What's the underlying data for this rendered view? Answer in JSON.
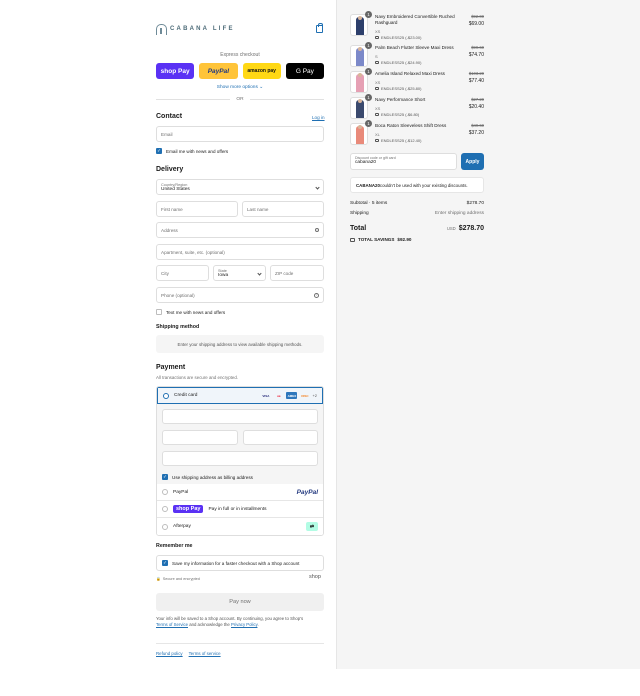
{
  "header": {
    "brand": "CABANA LIFE"
  },
  "express": {
    "title": "Express checkout",
    "shop_pay": "shop Pay",
    "paypal": "PayPal",
    "amazon_pay": "amazon pay",
    "gpay": "G Pay",
    "more": "Show more options ⌄",
    "or": "OR"
  },
  "contact": {
    "title": "Contact",
    "login": "Log in",
    "email_placeholder": "Email",
    "news_label": "Email me with news and offers"
  },
  "delivery": {
    "title": "Delivery",
    "country_label": "Country/Region",
    "country_value": "United States",
    "first_name": "First name",
    "last_name": "Last name",
    "address": "Address",
    "apartment": "Apartment, suite, etc. (optional)",
    "city": "City",
    "state_label": "State",
    "state_value": "Iowa",
    "zip": "ZIP code",
    "phone": "Phone (optional)",
    "text_label": "Text me with news and offers"
  },
  "shipping": {
    "title": "Shipping method",
    "info": "Enter your shipping address to view available shipping methods."
  },
  "payment": {
    "title": "Payment",
    "subtitle": "All transactions are secure and encrypted.",
    "credit_card": "Credit card",
    "cards": [
      "VISA",
      "MC",
      "AMEX",
      "DISC"
    ],
    "more_cards": "+2",
    "billing_label": "Use shipping address as billing address",
    "paypal": "PayPal",
    "paypal_logo": "PayPal",
    "shop_pay_logo": "shop Pay",
    "shop_pay_text": "Pay in full or in installments",
    "afterpay": "Afterpay"
  },
  "remember": {
    "title": "Remember me",
    "save_label": "Save my information for a faster checkout with a Shop account",
    "secure": "Secure and encrypted",
    "shop": "shop"
  },
  "pay_now": "Pay now",
  "legal": {
    "line1": "Your info will be saved to a Shop account. By continuing, you agree to Shop's",
    "terms": "Terms of Service",
    "and": " and acknowledge the ",
    "privacy": "Privacy Policy",
    "dot": "."
  },
  "footer": {
    "refund": "Refund policy",
    "terms": "Terms of service"
  },
  "items": [
    {
      "qty": "1",
      "name": "Navy Embroidered Convertible Ruched Rashguard",
      "variant": "XS",
      "discount": "ENDLESS25 (-$23.00)",
      "old": "$92.00",
      "price": "$69.00",
      "color": "#2d3f6b"
    },
    {
      "qty": "1",
      "name": "Palm Beach Flutter Sleeve Maxi Dress",
      "variant": "S",
      "discount": "ENDLESS25 (-$24.90)",
      "old": "$99.60",
      "price": "$74.70",
      "color": "#7c89c9"
    },
    {
      "qty": "1",
      "name": "Amelia Island Relaxed Maxi Dress",
      "variant": "XS",
      "discount": "ENDLESS25 (-$25.80)",
      "old": "$103.20",
      "price": "$77.40",
      "color": "#e6a0b4"
    },
    {
      "qty": "1",
      "name": "Navy Performance Short",
      "variant": "XS",
      "discount": "ENDLESS25 (-$6.80)",
      "old": "$27.20",
      "price": "$20.40",
      "color": "#3b4a6e"
    },
    {
      "qty": "1",
      "name": "Boca Raton Sleeveless Shift Dress",
      "variant": "XL",
      "discount": "ENDLESS25 (-$12.40)",
      "old": "$49.60",
      "price": "$37.20",
      "color": "#e98a7a"
    }
  ],
  "discount": {
    "label": "Discount code or gift card",
    "value": "cabana20",
    "apply": "Apply",
    "msg_code": "CABANA20",
    "msg_rest": " couldn't be used with your existing discounts."
  },
  "summary": {
    "subtotal_label": "Subtotal · 5 items",
    "subtotal_value": "$278.70",
    "shipping_label": "Shipping",
    "shipping_value": "Enter shipping address",
    "total_label": "Total",
    "currency": "USD",
    "total_value": "$278.70",
    "savings_label": "TOTAL SAVINGS",
    "savings_value": "$92.90"
  }
}
